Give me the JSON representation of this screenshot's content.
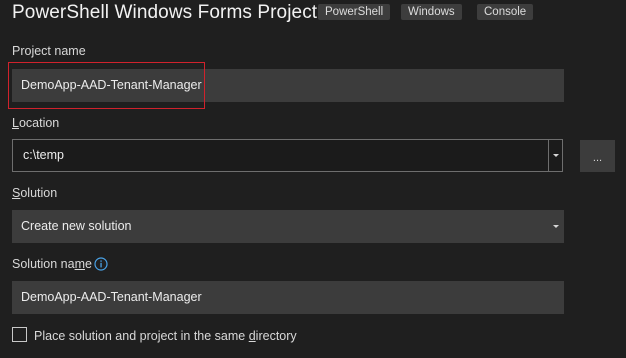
{
  "title": "PowerShell Windows Forms Project",
  "tags": [
    "PowerShell",
    "Windows",
    "Console"
  ],
  "project_name": {
    "label": "Project name",
    "value": "DemoApp-AAD-Tenant-Manager"
  },
  "location": {
    "label_accesskey": "L",
    "label_rest": "ocation",
    "value": "c:\\temp",
    "browse_label": "..."
  },
  "solution": {
    "label_accesskey": "S",
    "label_rest": "olution",
    "value": "Create new solution"
  },
  "solution_name": {
    "label_before": "Solution na",
    "label_accesskey": "m",
    "label_after": "e",
    "value": "DemoApp-AAD-Tenant-Manager",
    "info_icon": "info-icon"
  },
  "same_directory": {
    "checked": false,
    "label_before": "Place solution and project in the same ",
    "label_accesskey": "d",
    "label_after": "irectory"
  },
  "colors": {
    "background": "#1f1f1f",
    "field": "#3c3c3c",
    "highlight": "#d0222c",
    "info": "#4aa3e8"
  }
}
